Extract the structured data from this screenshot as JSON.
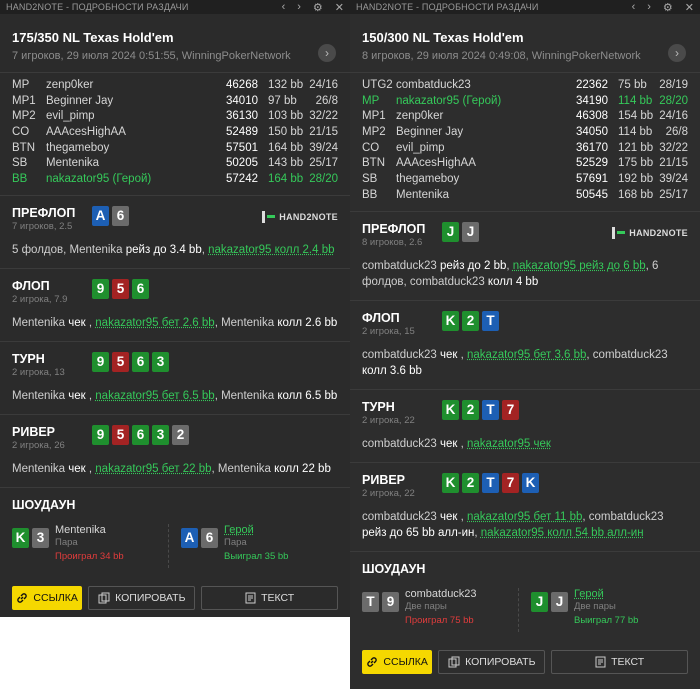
{
  "left": {
    "titlebar": {
      "title": "HAND2NOTE - ПОДРОБНОСТИ РАЗДАЧИ",
      "back": "‹",
      "forward": "›",
      "settings": "⚙",
      "close": "✕"
    },
    "game": "175/350 NL Texas Hold'em",
    "info": "7 игроков, 29 июля 2024 0:51:55, WinningPokerNetwork",
    "players": [
      {
        "pos": "MP",
        "name": "zenp0ker",
        "stack": "46268",
        "bb": "132 bb",
        "stats": "24/16",
        "hero": false
      },
      {
        "pos": "MP1",
        "name": "Beginner Jay",
        "stack": "34010",
        "bb": "97 bb",
        "stats": "26/8",
        "hero": false
      },
      {
        "pos": "MP2",
        "name": "evil_pimp",
        "stack": "36130",
        "bb": "103 bb",
        "stats": "32/22",
        "hero": false
      },
      {
        "pos": "CO",
        "name": "AAAcesHighAA",
        "stack": "52489",
        "bb": "150 bb",
        "stats": "21/15",
        "hero": false
      },
      {
        "pos": "BTN",
        "name": "thegameboy",
        "stack": "57501",
        "bb": "164 bb",
        "stats": "39/24",
        "hero": false
      },
      {
        "pos": "SB",
        "name": "Mentenika",
        "stack": "50205",
        "bb": "143 bb",
        "stats": "25/17",
        "hero": false
      },
      {
        "pos": "BB",
        "name": "nakazator95 (Герой)",
        "stack": "57242",
        "bb": "164 bb",
        "stats": "28/20",
        "hero": true
      }
    ],
    "logo": "HAND2NOTE",
    "streets": [
      {
        "name": "ПРЕФЛОП",
        "sub": "7 игроков, 2.5",
        "cards": [
          {
            "r": "A",
            "c": "b"
          },
          {
            "r": "6",
            "c": "k"
          }
        ],
        "actions": [
          {
            "t": "5 фолдов, Mentenika ",
            "s": ""
          },
          {
            "t": "рейз до 3.4 bb",
            "s": "verb"
          },
          {
            "t": ", ",
            "s": ""
          },
          {
            "t": "nakazator95 колл 2.4 bb",
            "s": "ap"
          }
        ]
      },
      {
        "name": "ФЛОП",
        "sub": "2 игрока, 7.9",
        "cards": [
          {
            "r": "9",
            "c": "g"
          },
          {
            "r": "5",
            "c": "r"
          },
          {
            "r": "6",
            "c": "g"
          }
        ],
        "actions": [
          {
            "t": "Mentenika ",
            "s": ""
          },
          {
            "t": "чек",
            "s": "verb"
          },
          {
            "t": " , ",
            "s": ""
          },
          {
            "t": "nakazator95 бет 2.6 bb",
            "s": "ap"
          },
          {
            "t": ", Mentenika ",
            "s": ""
          },
          {
            "t": "колл 2.6 bb",
            "s": "verb"
          }
        ]
      },
      {
        "name": "ТУРН",
        "sub": "2 игрока, 13",
        "cards": [
          {
            "r": "9",
            "c": "g"
          },
          {
            "r": "5",
            "c": "r"
          },
          {
            "r": "6",
            "c": "g"
          },
          {
            "r": "3",
            "c": "g"
          }
        ],
        "actions": [
          {
            "t": "Mentenika ",
            "s": ""
          },
          {
            "t": "чек",
            "s": "verb"
          },
          {
            "t": " , ",
            "s": ""
          },
          {
            "t": "nakazator95 бет 6.5 bb",
            "s": "ap"
          },
          {
            "t": ", Mentenika ",
            "s": ""
          },
          {
            "t": "колл 6.5 bb",
            "s": "verb"
          }
        ]
      },
      {
        "name": "РИВЕР",
        "sub": "2 игрока, 26",
        "cards": [
          {
            "r": "9",
            "c": "g"
          },
          {
            "r": "5",
            "c": "r"
          },
          {
            "r": "6",
            "c": "g"
          },
          {
            "r": "3",
            "c": "g"
          },
          {
            "r": "2",
            "c": "k"
          }
        ],
        "actions": [
          {
            "t": "Mentenika ",
            "s": ""
          },
          {
            "t": "чек",
            "s": "verb"
          },
          {
            "t": " , ",
            "s": ""
          },
          {
            "t": "nakazator95 бет 22 bb",
            "s": "ap"
          },
          {
            "t": ", Mentenika ",
            "s": ""
          },
          {
            "t": "колл 22 bb",
            "s": "verb"
          }
        ]
      }
    ],
    "showdown": {
      "title": "ШОУДАУН",
      "players": [
        {
          "name": "Mentenika",
          "hand": "Пара",
          "result": "Проиграл 34 bb",
          "won": false,
          "hero": false,
          "cards": [
            {
              "r": "K",
              "c": "g"
            },
            {
              "r": "3",
              "c": "k"
            }
          ]
        },
        {
          "name": "Герой",
          "hand": "Пара",
          "result": "Выиграл 35 bb",
          "won": true,
          "hero": true,
          "cards": [
            {
              "r": "A",
              "c": "b"
            },
            {
              "r": "6",
              "c": "k"
            }
          ]
        }
      ]
    },
    "buttons": {
      "link": "ССЫЛКА",
      "copy": "КОПИРОВАТЬ",
      "text": "ТЕКСТ"
    }
  },
  "right": {
    "titlebar": {
      "title": "HAND2NOTE - ПОДРОБНОСТИ РАЗДАЧИ",
      "back": "‹",
      "forward": "›",
      "settings": "⚙",
      "close": "✕"
    },
    "game": "150/300 NL Texas Hold'em",
    "info": "8 игроков, 29 июля 2024 0:49:08, WinningPokerNetwork",
    "players": [
      {
        "pos": "UTG2",
        "name": "combatduck23",
        "stack": "22362",
        "bb": "75 bb",
        "stats": "28/19",
        "hero": false
      },
      {
        "pos": "MP",
        "name": "nakazator95 (Герой)",
        "stack": "34190",
        "bb": "114 bb",
        "stats": "28/20",
        "hero": true
      },
      {
        "pos": "MP1",
        "name": "zenp0ker",
        "stack": "46308",
        "bb": "154 bb",
        "stats": "24/16",
        "hero": false
      },
      {
        "pos": "MP2",
        "name": "Beginner Jay",
        "stack": "34050",
        "bb": "114 bb",
        "stats": "26/8",
        "hero": false
      },
      {
        "pos": "CO",
        "name": "evil_pimp",
        "stack": "36170",
        "bb": "121 bb",
        "stats": "32/22",
        "hero": false
      },
      {
        "pos": "BTN",
        "name": "AAAcesHighAA",
        "stack": "52529",
        "bb": "175 bb",
        "stats": "21/15",
        "hero": false
      },
      {
        "pos": "SB",
        "name": "thegameboy",
        "stack": "57691",
        "bb": "192 bb",
        "stats": "39/24",
        "hero": false
      },
      {
        "pos": "BB",
        "name": "Mentenika",
        "stack": "50545",
        "bb": "168 bb",
        "stats": "25/17",
        "hero": false
      }
    ],
    "logo": "HAND2NOTE",
    "streets": [
      {
        "name": "ПРЕФЛОП",
        "sub": "8 игроков, 2.6",
        "cards": [
          {
            "r": "J",
            "c": "g"
          },
          {
            "r": "J",
            "c": "k"
          }
        ],
        "actions": [
          {
            "t": "combatduck23 ",
            "s": ""
          },
          {
            "t": "рейз до 2 bb",
            "s": "verb"
          },
          {
            "t": ", ",
            "s": ""
          },
          {
            "t": "nakazator95 рейз до 6 bb",
            "s": "ap"
          },
          {
            "t": ", 6 фолдов, combatduck23 ",
            "s": ""
          },
          {
            "t": "колл 4 bb",
            "s": "verb"
          }
        ]
      },
      {
        "name": "ФЛОП",
        "sub": "2 игрока, 15",
        "cards": [
          {
            "r": "K",
            "c": "g"
          },
          {
            "r": "2",
            "c": "g"
          },
          {
            "r": "T",
            "c": "b"
          }
        ],
        "actions": [
          {
            "t": "combatduck23 ",
            "s": ""
          },
          {
            "t": "чек",
            "s": "verb"
          },
          {
            "t": " , ",
            "s": ""
          },
          {
            "t": "nakazator95 бет 3.6 bb",
            "s": "ap"
          },
          {
            "t": ", combatduck23 ",
            "s": ""
          },
          {
            "t": "колл 3.6 bb",
            "s": "verb"
          }
        ]
      },
      {
        "name": "ТУРН",
        "sub": "2 игрока, 22",
        "cards": [
          {
            "r": "K",
            "c": "g"
          },
          {
            "r": "2",
            "c": "g"
          },
          {
            "r": "T",
            "c": "b"
          },
          {
            "r": "7",
            "c": "r"
          }
        ],
        "actions": [
          {
            "t": "combatduck23 ",
            "s": ""
          },
          {
            "t": "чек",
            "s": "verb"
          },
          {
            "t": " , ",
            "s": ""
          },
          {
            "t": "nakazator95 чек",
            "s": "ap"
          }
        ]
      },
      {
        "name": "РИВЕР",
        "sub": "2 игрока, 22",
        "cards": [
          {
            "r": "K",
            "c": "g"
          },
          {
            "r": "2",
            "c": "g"
          },
          {
            "r": "T",
            "c": "b"
          },
          {
            "r": "7",
            "c": "r"
          },
          {
            "r": "K",
            "c": "b"
          }
        ],
        "actions": [
          {
            "t": "combatduck23 ",
            "s": ""
          },
          {
            "t": "чек",
            "s": "verb"
          },
          {
            "t": " , ",
            "s": ""
          },
          {
            "t": "nakazator95 бет 11 bb",
            "s": "ap"
          },
          {
            "t": ", combatduck23 ",
            "s": ""
          },
          {
            "t": "рейз до 65 bb алл-ин",
            "s": "verb"
          },
          {
            "t": ", ",
            "s": ""
          },
          {
            "t": "nakazator95 колл 54 bb алл-ин",
            "s": "ap"
          }
        ]
      }
    ],
    "showdown": {
      "title": "ШОУДАУН",
      "players": [
        {
          "name": "combatduck23",
          "hand": "Две пары",
          "result": "Проиграл 75 bb",
          "won": false,
          "hero": false,
          "cards": [
            {
              "r": "T",
              "c": "k"
            },
            {
              "r": "9",
              "c": "k"
            }
          ]
        },
        {
          "name": "Герой",
          "hand": "Две пары",
          "result": "Выиграл 77 bb",
          "won": true,
          "hero": true,
          "cards": [
            {
              "r": "J",
              "c": "g"
            },
            {
              "r": "J",
              "c": "k"
            }
          ]
        }
      ]
    },
    "buttons": {
      "link": "ССЫЛКА",
      "copy": "КОПИРОВАТЬ",
      "text": "ТЕКСТ"
    }
  },
  "colors": {
    "hero": "#35c95a",
    "lost": "#e03c3c",
    "button_yellow": "#f5d800",
    "card_green": "#1f8f2e",
    "card_red": "#a32323",
    "card_blue": "#1d5fb4",
    "card_gray": "#6b6b6b"
  },
  "icons": {
    "link": "link-icon",
    "copy": "copy-icon",
    "text": "document-icon",
    "settings": "gear-icon",
    "next": "chevron-right-icon"
  }
}
